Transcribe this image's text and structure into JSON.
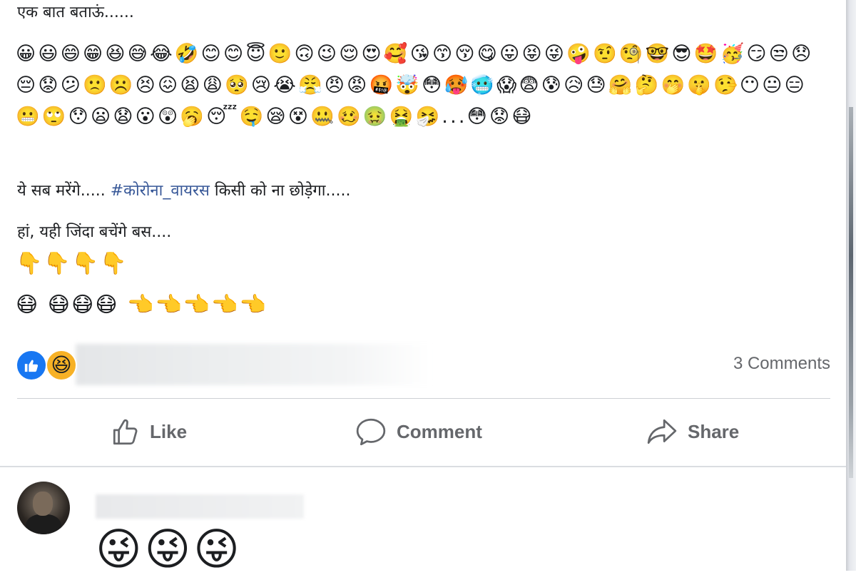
{
  "post": {
    "intro_text": "एक बात बताऊं......",
    "emoji_grid": "😀😃😄😁😆😅😂🤣😊😊😇🙂🙃😉😌😍🥰😘😙😚😋😛😝😜🤪🤨🧐🤓😎🤩🥳😏😒😞😔😟😕🙁☹️😣😖😫😩🥺😢😭😤😠😡🤬🤯😳🥵🥶😱😨😰😥😓🤗🤔🤭🤫🤥😶😐😑😬🙄😯😦😧😮😲🥱😴🤤😪😵🤐🥴🤢🤮🤧...😳😟😷",
    "line_before": "ये सब मरेंगे..... ",
    "hashtag": "#कोरोना_वायरस",
    "line_after": " किसी को ना छोड़ेगा.....",
    "survivors_text": "हां, यही जिंदा बचेंगे बस....",
    "pointing_down": "👇👇👇👇",
    "masks_and_points": "😷 😷😷😷 👈👈👈👈👈"
  },
  "reactions": {
    "like_icon": "thumbs-up-icon",
    "haha_emoji": "😆",
    "comments_count": "3 Comments"
  },
  "actions": {
    "like_label": "Like",
    "comment_label": "Comment",
    "share_label": "Share"
  },
  "comment": {
    "text": "😜😜😜"
  },
  "colors": {
    "hashtag": "#385898",
    "like_blue": "#1877f2",
    "secondary_text": "#65676b",
    "divider": "#ced0d4"
  }
}
